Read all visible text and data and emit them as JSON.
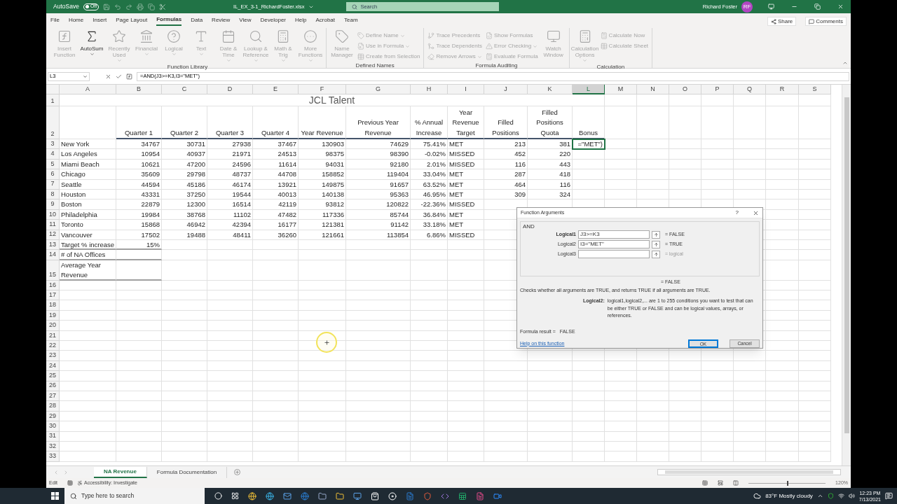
{
  "title_bar": {
    "autosave_label": "AutoSave",
    "autosave": {
      "on": false,
      "label": "Off"
    },
    "file_name": "IL_EX_3-1_RichardFoster.xlsx",
    "search_placeholder": "Search",
    "user_name": "Richard Foster",
    "user_initials": "RF"
  },
  "ribbon_tabs": [
    {
      "label": "File",
      "selected": false
    },
    {
      "label": "Home",
      "selected": false
    },
    {
      "label": "Insert",
      "selected": false
    },
    {
      "label": "Page Layout",
      "selected": false
    },
    {
      "label": "Formulas",
      "selected": true
    },
    {
      "label": "Data",
      "selected": false
    },
    {
      "label": "Review",
      "selected": false
    },
    {
      "label": "View",
      "selected": false
    },
    {
      "label": "Developer",
      "selected": false
    },
    {
      "label": "Help",
      "selected": false
    },
    {
      "label": "Acrobat",
      "selected": false
    },
    {
      "label": "Team",
      "selected": false
    }
  ],
  "share": "Share",
  "comments": "Comments",
  "ribbon_groups": [
    {
      "label": "Function Library",
      "items": [
        {
          "label": "Insert Function",
          "kind": "large",
          "disabled": true,
          "menu": false
        },
        {
          "label": "AutoSum",
          "kind": "large",
          "disabled": false,
          "menu": true
        },
        {
          "label": "Recently Used",
          "kind": "large",
          "disabled": true,
          "menu": true
        },
        {
          "label": "Financial",
          "kind": "large",
          "disabled": true,
          "menu": true
        },
        {
          "label": "Logical",
          "kind": "large",
          "disabled": true,
          "menu": true
        },
        {
          "label": "Text",
          "kind": "large",
          "disabled": true,
          "menu": true
        },
        {
          "label": "Date & Time",
          "kind": "large",
          "disabled": true,
          "menu": true
        },
        {
          "label": "Lookup & Reference",
          "kind": "large",
          "disabled": true,
          "menu": true
        },
        {
          "label": "Math & Trig",
          "kind": "large",
          "disabled": true,
          "menu": true
        },
        {
          "label": "More Functions",
          "kind": "large",
          "disabled": true,
          "menu": true
        }
      ]
    },
    {
      "label": "Defined Names",
      "items": [
        {
          "label": "Name Manager",
          "kind": "large",
          "disabled": true,
          "menu": false
        },
        {
          "label": "Define Name",
          "kind": "small",
          "disabled": true,
          "menu": true
        },
        {
          "label": "Use in Formula",
          "kind": "small",
          "disabled": true,
          "menu": true
        },
        {
          "label": "Create from Selection",
          "kind": "small",
          "disabled": true,
          "menu": false
        }
      ]
    },
    {
      "label": "Formula Auditing",
      "items": [
        {
          "label": "Trace Precedents",
          "kind": "small",
          "disabled": true,
          "menu": false
        },
        {
          "label": "Trace Dependents",
          "kind": "small",
          "disabled": true,
          "menu": false
        },
        {
          "label": "Remove Arrows",
          "kind": "small",
          "disabled": true,
          "menu": true
        },
        {
          "label": "Show Formulas",
          "kind": "small",
          "disabled": true,
          "menu": false
        },
        {
          "label": "Error Checking",
          "kind": "small",
          "disabled": true,
          "menu": true
        },
        {
          "label": "Evaluate Formula",
          "kind": "small",
          "disabled": true,
          "menu": false
        },
        {
          "label": "Watch Window",
          "kind": "large",
          "disabled": true,
          "menu": false
        }
      ]
    },
    {
      "label": "Calculation",
      "items": [
        {
          "label": "Calculation Options",
          "kind": "large",
          "disabled": true,
          "menu": true
        },
        {
          "label": "Calculate Now",
          "kind": "small",
          "disabled": true,
          "menu": false
        },
        {
          "label": "Calculate Sheet",
          "kind": "small",
          "disabled": true,
          "menu": false
        }
      ]
    }
  ],
  "formula_bar": {
    "name_box": "L3",
    "formula": "=AND(J3>=K3,I3=\"MET\")"
  },
  "sheet": {
    "columns": [
      {
        "label": "A",
        "selected": false
      },
      {
        "label": "B",
        "selected": false
      },
      {
        "label": "C",
        "selected": false
      },
      {
        "label": "D",
        "selected": false
      },
      {
        "label": "E",
        "selected": false
      },
      {
        "label": "F",
        "selected": false
      },
      {
        "label": "G",
        "selected": false
      },
      {
        "label": "H",
        "selected": false
      },
      {
        "label": "I",
        "selected": false
      },
      {
        "label": "J",
        "selected": false
      },
      {
        "label": "K",
        "selected": false
      },
      {
        "label": "L",
        "selected": true
      },
      {
        "label": "M",
        "selected": false
      },
      {
        "label": "N",
        "selected": false
      },
      {
        "label": "O",
        "selected": false
      },
      {
        "label": "P",
        "selected": false
      },
      {
        "label": "Q",
        "selected": false
      },
      {
        "label": "R",
        "selected": false
      },
      {
        "label": "S",
        "selected": false
      }
    ],
    "rows": [
      {
        "number": "1",
        "kind": "title",
        "cells": {
          "A": "JCL Talent"
        }
      },
      {
        "number": "2",
        "kind": "header",
        "cells": {
          "B": "Quarter 1",
          "C": "Quarter 2",
          "D": "Quarter 3",
          "E": "Quarter 4",
          "F": "Year Revenue",
          "G": "Previous Year Revenue",
          "H": "% Annual Increase",
          "I": "Year Revenue Target",
          "J": "Filled Positions",
          "K": "Filled Positions Quota",
          "L": "Bonus"
        }
      },
      {
        "number": "3",
        "kind": "data",
        "cells": {
          "A": "New York",
          "B": "34767",
          "C": "30731",
          "D": "27938",
          "E": "37467",
          "F": "130903",
          "G": "74629",
          "H": "75.41%",
          "I": "MET",
          "J": "213",
          "K": "381",
          "L": {
            "text": "=\"MET\")",
            "editing": true
          }
        }
      },
      {
        "number": "4",
        "kind": "data",
        "cells": {
          "A": "Los Angeles",
          "B": "10954",
          "C": "40937",
          "D": "21971",
          "E": "24513",
          "F": "98375",
          "G": "98390",
          "H": "-0.02%",
          "I": "MISSED",
          "J": "452",
          "K": "220"
        }
      },
      {
        "number": "5",
        "kind": "data",
        "cells": {
          "A": "Miami Beach",
          "B": "10621",
          "C": "47200",
          "D": "24596",
          "E": "11614",
          "F": "94031",
          "G": "92180",
          "H": "2.01%",
          "I": "MISSED",
          "J": "116",
          "K": "443"
        }
      },
      {
        "number": "6",
        "kind": "data",
        "cells": {
          "A": "Chicago",
          "B": "35609",
          "C": "29798",
          "D": "48737",
          "E": "44708",
          "F": "158852",
          "G": "119404",
          "H": "33.04%",
          "I": "MET",
          "J": "287",
          "K": "418"
        }
      },
      {
        "number": "7",
        "kind": "data",
        "cells": {
          "A": "Seattle",
          "B": "44594",
          "C": "45186",
          "D": "46174",
          "E": "13921",
          "F": "149875",
          "G": "91657",
          "H": "63.52%",
          "I": "MET",
          "J": "464",
          "K": "116"
        }
      },
      {
        "number": "8",
        "kind": "data",
        "cells": {
          "A": "Houston",
          "B": "43331",
          "C": "37250",
          "D": "19544",
          "E": "40013",
          "F": "140138",
          "G": "95363",
          "H": "46.95%",
          "I": "MET",
          "J": "309",
          "K": "324"
        }
      },
      {
        "number": "9",
        "kind": "data",
        "cells": {
          "A": "Boston",
          "B": "22879",
          "C": "12300",
          "D": "16514",
          "E": "42119",
          "F": "93812",
          "G": "120822",
          "H": "-22.36%",
          "I": "MISSED"
        }
      },
      {
        "number": "10",
        "kind": "data",
        "cells": {
          "A": "Philadelphia",
          "B": "19984",
          "C": "38768",
          "D": "11102",
          "E": "47482",
          "F": "117336",
          "G": "85744",
          "H": "36.84%",
          "I": "MET"
        }
      },
      {
        "number": "11",
        "kind": "data",
        "cells": {
          "A": "Toronto",
          "B": "15868",
          "C": "46942",
          "D": "42394",
          "E": "16177",
          "F": "121381",
          "G": "91142",
          "H": "33.18%",
          "I": "MET"
        }
      },
      {
        "number": "12",
        "kind": "data",
        "cells": {
          "A": "Vancouver",
          "B": "17502",
          "C": "19488",
          "D": "48411",
          "E": "36260",
          "F": "121661",
          "G": "113854",
          "H": "6.86%",
          "I": "MISSED"
        }
      },
      {
        "number": "13",
        "kind": "summary",
        "wrapped": false,
        "cells": {
          "A": "Target % increase",
          "B": "15%"
        }
      },
      {
        "number": "14",
        "kind": "summary",
        "wrapped": false,
        "cells": {
          "A": "# of NA Offices"
        }
      },
      {
        "number": "15",
        "kind": "summary",
        "wrapped": true,
        "cells": {
          "A": "Average Year Revenue"
        }
      },
      {
        "number": "16",
        "kind": "blank"
      },
      {
        "number": "17",
        "kind": "blank"
      },
      {
        "number": "18",
        "kind": "blank"
      },
      {
        "number": "19",
        "kind": "blank"
      },
      {
        "number": "20",
        "kind": "blank"
      },
      {
        "number": "21",
        "kind": "blank"
      },
      {
        "number": "22",
        "kind": "blank"
      },
      {
        "number": "23",
        "kind": "blank"
      },
      {
        "number": "24",
        "kind": "blank"
      },
      {
        "number": "25",
        "kind": "blank"
      },
      {
        "number": "26",
        "kind": "blank"
      },
      {
        "number": "27",
        "kind": "blank"
      },
      {
        "number": "28",
        "kind": "blank"
      },
      {
        "number": "29",
        "kind": "blank"
      },
      {
        "number": "30",
        "kind": "blank"
      },
      {
        "number": "31",
        "kind": "blank"
      },
      {
        "number": "32",
        "kind": "blank"
      },
      {
        "number": "33",
        "kind": "blank"
      }
    ]
  },
  "dialog": {
    "title": "Function Arguments",
    "help_mark": "?",
    "function_name": "AND",
    "args": [
      {
        "label": "Logical1",
        "value": "J3>=K3",
        "result": "= FALSE",
        "required": true,
        "muted": false
      },
      {
        "label": "Logical2",
        "value": "I3=\"MET\"",
        "result": "= TRUE",
        "required": false,
        "muted": false
      },
      {
        "label": "Logical3",
        "result": "= logical",
        "required": false,
        "muted": true
      }
    ],
    "result": "= FALSE",
    "description": "Checks whether all arguments are TRUE, and returns TRUE if all arguments are TRUE.",
    "arg_help_label": "Logical2:",
    "arg_help": "logical1,logical2,... are 1 to 255 conditions you want to test that can be either TRUE or FALSE and can be logical values, arrays, or references.",
    "formula_result_label": "Formula result =",
    "formula_result": "FALSE",
    "help_link": "Help on this function",
    "buttons": [
      {
        "label": "OK",
        "default": true
      },
      {
        "label": "Cancel",
        "default": false
      }
    ]
  },
  "sheet_tabs": [
    {
      "label": "NA Revenue",
      "selected": true
    },
    {
      "label": "Formula Documentation",
      "selected": false
    }
  ],
  "status_bar": {
    "mode": "Edit",
    "accessibility": "Accessibility: Investigate",
    "zoom": "120%",
    "zoom_slider": {
      "level": 0.5
    }
  },
  "taskbar": {
    "search_placeholder": "Type here to search",
    "weather": "83°F Mostly cloudy",
    "time": "12:23 PM",
    "date": "7/13/2021"
  }
}
